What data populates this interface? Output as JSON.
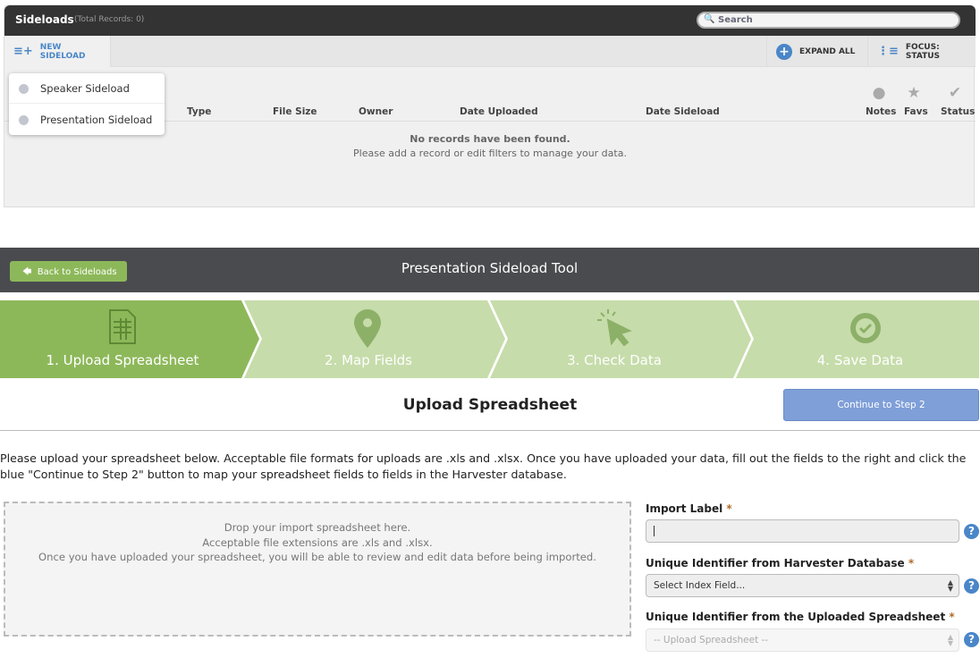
{
  "sideloads": {
    "title": "Sideloads",
    "count": "(Total Records: 0)",
    "search_placeholder": "Search",
    "new_label": "NEW SIDELOAD",
    "expand_label": "EXPAND ALL",
    "focus_label": "FOCUS: STATUS",
    "columns": [
      "Type",
      "File Size",
      "Owner",
      "Date Uploaded",
      "Date Sideload",
      "Notes",
      "Favs",
      "Status"
    ],
    "empty_title": "No records have been found.",
    "empty_sub": "Please add a record or edit filters to manage your data.",
    "menu": [
      "Speaker Sideload",
      "Presentation Sideload"
    ]
  },
  "tool": {
    "back_label": "Back to Sideloads",
    "title": "Presentation Sideload Tool",
    "steps": [
      {
        "label": "1. Upload Spreadsheet",
        "icon": "spreadsheet-icon",
        "active": true
      },
      {
        "label": "2. Map Fields",
        "icon": "map-pin-icon",
        "active": false
      },
      {
        "label": "3. Check Data",
        "icon": "cursor-click-icon",
        "active": false
      },
      {
        "label": "4. Save Data",
        "icon": "gear-check-icon",
        "active": false
      }
    ],
    "heading": "Upload Spreadsheet",
    "continue_label": "Continue to Step 2",
    "instructions": "Please upload your spreadsheet below. Acceptable file formats for uploads are .xls and .xlsx. Once you have uploaded your data, fill out the fields to the right and click the blue \"Continue to Step 2\" button to map your spreadsheet fields to fields in the Harvester database.",
    "drop": [
      "Drop your import spreadsheet here.",
      "Acceptable file extensions are .xls and .xlsx.",
      "Once you have uploaded your spreadsheet, you will be able to review and edit data before being imported."
    ],
    "form": {
      "import_label": "Import Label",
      "import_value": "",
      "harvester_label": "Unique Identifier from Harvester Database",
      "harvester_value": "Select Index Field...",
      "sheet_label": "Unique Identifier from the Uploaded Spreadsheet",
      "sheet_value": "-- Upload Spreadsheet --",
      "required": "*",
      "help": "?"
    }
  },
  "colors": {
    "active_step": "#8db85a",
    "inactive_step": "#c6dcaa",
    "accent": "#4a86c8",
    "continue": "#7f9fd8"
  }
}
